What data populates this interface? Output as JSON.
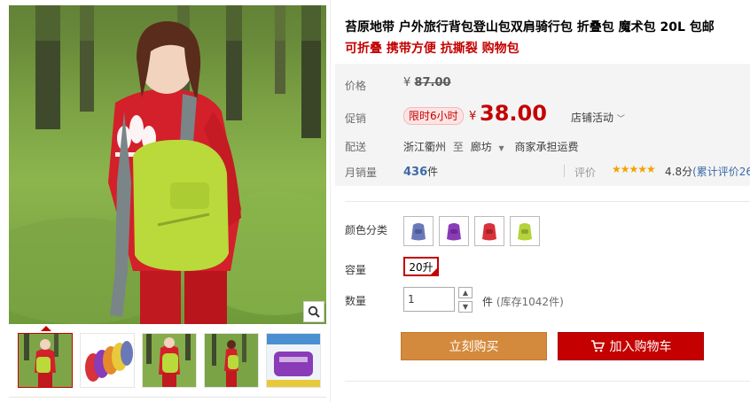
{
  "product": {
    "title": "苔原地带 户外旅行背包登山包双肩骑行包 折叠包 魔术包 20L 包邮",
    "subtitle": "可折叠 携带方便 抗撕裂 购物包"
  },
  "price": {
    "label": "价格",
    "currency": "¥",
    "original": "87.00"
  },
  "promo": {
    "label": "促销",
    "badge": "限时6小时",
    "currency": "¥",
    "price": "38.00",
    "shop_activity": "店铺活动"
  },
  "shipping": {
    "label": "配送",
    "from": "浙江衢州",
    "to_word": "至",
    "destination": "廊坊",
    "fee": "商家承担运费"
  },
  "sales": {
    "label": "月销量",
    "count": "436",
    "unit": "件",
    "rating_label": "评价",
    "stars": "★★★★★",
    "score": "4.8分",
    "review_link": "(累计评价26"
  },
  "options": {
    "color_label": "颜色分类",
    "colors": [
      "#6b78b8",
      "#8a3bb8",
      "#d9323a",
      "#b5d33a"
    ],
    "capacity_label": "容量",
    "capacity_value": "20升",
    "quantity_label": "数量",
    "quantity_value": "1",
    "stock_unit": "件",
    "stock_text": "(库存1042件)"
  },
  "actions": {
    "buy_now": "立刻购买",
    "add_to_cart": "加入购物车"
  },
  "colors": {
    "accent_red": "#c40000",
    "buy_orange": "#d48a3c",
    "link_blue": "#3c6aa8"
  }
}
